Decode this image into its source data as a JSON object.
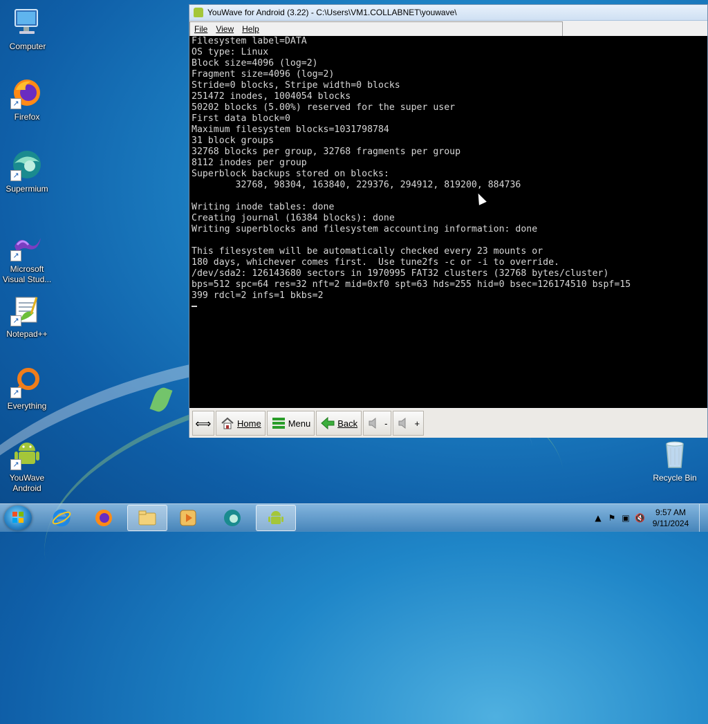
{
  "desktop": {
    "icons": [
      {
        "label": "Computer"
      },
      {
        "label": "Firefox"
      },
      {
        "label": "Supermium"
      },
      {
        "label": "Microsoft Visual Stud..."
      },
      {
        "label": "Notepad++"
      },
      {
        "label": "Everything"
      },
      {
        "label": "YouWave Android"
      }
    ],
    "recycle_bin": "Recycle Bin"
  },
  "window": {
    "title": "YouWave for Android (3.22) - C:\\Users\\VM1.COLLABNET\\youwave\\",
    "menu": [
      "File",
      "View",
      "Help"
    ],
    "console_lines": [
      "Filesystem label=DATA",
      "OS type: Linux",
      "Block size=4096 (log=2)",
      "Fragment size=4096 (log=2)",
      "Stride=0 blocks, Stripe width=0 blocks",
      "251472 inodes, 1004054 blocks",
      "50202 blocks (5.00%) reserved for the super user",
      "First data block=0",
      "Maximum filesystem blocks=1031798784",
      "31 block groups",
      "32768 blocks per group, 32768 fragments per group",
      "8112 inodes per group",
      "Superblock backups stored on blocks:",
      "        32768, 98304, 163840, 229376, 294912, 819200, 884736",
      "",
      "Writing inode tables: done",
      "Creating journal (16384 blocks): done",
      "Writing superblocks and filesystem accounting information: done",
      "",
      "This filesystem will be automatically checked every 23 mounts or",
      "180 days, whichever comes first.  Use tune2fs -c or -i to override.",
      "/dev/sda2: 126143680 sectors in 1970995 FAT32 clusters (32768 bytes/cluster)",
      "bps=512 spc=64 res=32 nft=2 mid=0xf0 spt=63 hds=255 hid=0 bsec=126174510 bspf=15",
      "399 rdcl=2 infs=1 bkbs=2"
    ],
    "toolbar": {
      "home": "Home",
      "menu": "Menu",
      "back": "Back",
      "vol_down": "-",
      "vol_up": "+"
    }
  },
  "taskbar": {
    "time": "9:57 AM",
    "date": "9/11/2024"
  }
}
